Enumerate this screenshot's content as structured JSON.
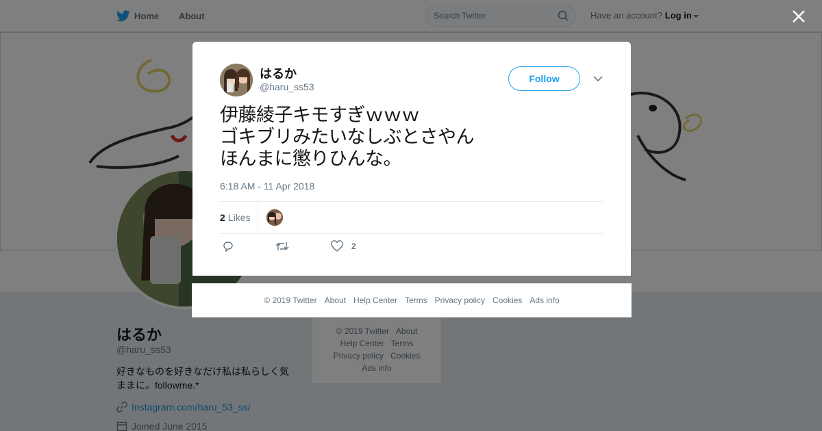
{
  "topbar": {
    "home_label": "Home",
    "about_label": "About",
    "search_placeholder": "Search Twitter",
    "account_prompt": "Have an account?",
    "login_label": "Log in"
  },
  "profile": {
    "name": "はるか",
    "handle": "@haru_ss53",
    "bio": "好きなものを好きなだけ私は私らしく気ままに。followme.*",
    "link": "Instagram.com/haru_53_ss/",
    "joined": "Joined June 2015"
  },
  "sidebar_footer": {
    "items": [
      "© 2019 Twitter",
      "About",
      "Help Center",
      "Terms",
      "Privacy policy",
      "Cookies",
      "Ads info"
    ]
  },
  "tweet": {
    "name": "はるか",
    "handle": "@haru_ss53",
    "follow_label": "Follow",
    "text": "伊藤綾子キモすぎｗｗｗ\nゴキブリみたいなしぶとさやん\nほんまに懲りひんな。",
    "timestamp": "6:18 AM - 11 Apr 2018",
    "likes_count": "2",
    "likes_label": "Likes",
    "like_action_count": "2"
  },
  "modal_footer": {
    "items": [
      "© 2019 Twitter",
      "About",
      "Help Center",
      "Terms",
      "Privacy policy",
      "Cookies",
      "Ads info"
    ]
  },
  "colors": {
    "twitter_blue": "#1da1f2",
    "link_blue": "#1b95e0",
    "secondary_text": "#657786",
    "overlay": "rgba(0,0,0,0.5)"
  },
  "icons": [
    "twitter-bird-icon",
    "search-icon",
    "close-icon",
    "chevron-down-icon",
    "reply-icon",
    "retweet-icon",
    "heart-icon",
    "link-icon",
    "calendar-icon"
  ]
}
